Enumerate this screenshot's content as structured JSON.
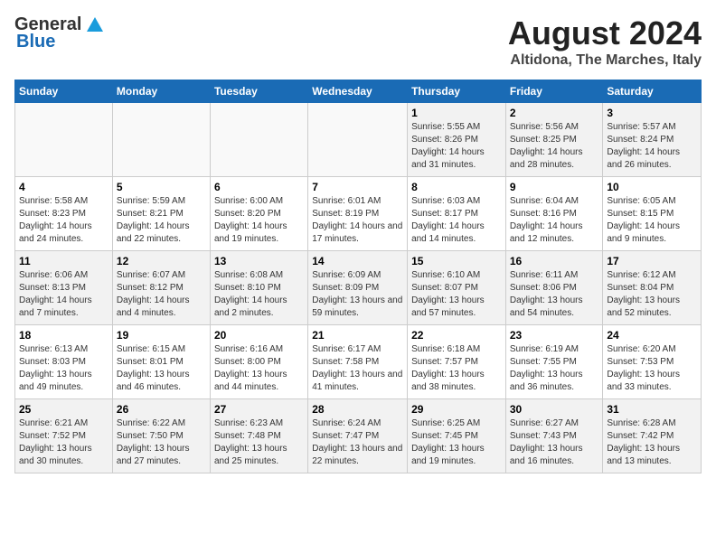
{
  "header": {
    "logo_general": "General",
    "logo_blue": "Blue",
    "month_title": "August 2024",
    "location": "Altidona, The Marches, Italy"
  },
  "days_of_week": [
    "Sunday",
    "Monday",
    "Tuesday",
    "Wednesday",
    "Thursday",
    "Friday",
    "Saturday"
  ],
  "weeks": [
    [
      {
        "day": "",
        "info": ""
      },
      {
        "day": "",
        "info": ""
      },
      {
        "day": "",
        "info": ""
      },
      {
        "day": "",
        "info": ""
      },
      {
        "day": "1",
        "info": "Sunrise: 5:55 AM\nSunset: 8:26 PM\nDaylight: 14 hours and 31 minutes."
      },
      {
        "day": "2",
        "info": "Sunrise: 5:56 AM\nSunset: 8:25 PM\nDaylight: 14 hours and 28 minutes."
      },
      {
        "day": "3",
        "info": "Sunrise: 5:57 AM\nSunset: 8:24 PM\nDaylight: 14 hours and 26 minutes."
      }
    ],
    [
      {
        "day": "4",
        "info": "Sunrise: 5:58 AM\nSunset: 8:23 PM\nDaylight: 14 hours and 24 minutes."
      },
      {
        "day": "5",
        "info": "Sunrise: 5:59 AM\nSunset: 8:21 PM\nDaylight: 14 hours and 22 minutes."
      },
      {
        "day": "6",
        "info": "Sunrise: 6:00 AM\nSunset: 8:20 PM\nDaylight: 14 hours and 19 minutes."
      },
      {
        "day": "7",
        "info": "Sunrise: 6:01 AM\nSunset: 8:19 PM\nDaylight: 14 hours and 17 minutes."
      },
      {
        "day": "8",
        "info": "Sunrise: 6:03 AM\nSunset: 8:17 PM\nDaylight: 14 hours and 14 minutes."
      },
      {
        "day": "9",
        "info": "Sunrise: 6:04 AM\nSunset: 8:16 PM\nDaylight: 14 hours and 12 minutes."
      },
      {
        "day": "10",
        "info": "Sunrise: 6:05 AM\nSunset: 8:15 PM\nDaylight: 14 hours and 9 minutes."
      }
    ],
    [
      {
        "day": "11",
        "info": "Sunrise: 6:06 AM\nSunset: 8:13 PM\nDaylight: 14 hours and 7 minutes."
      },
      {
        "day": "12",
        "info": "Sunrise: 6:07 AM\nSunset: 8:12 PM\nDaylight: 14 hours and 4 minutes."
      },
      {
        "day": "13",
        "info": "Sunrise: 6:08 AM\nSunset: 8:10 PM\nDaylight: 14 hours and 2 minutes."
      },
      {
        "day": "14",
        "info": "Sunrise: 6:09 AM\nSunset: 8:09 PM\nDaylight: 13 hours and 59 minutes."
      },
      {
        "day": "15",
        "info": "Sunrise: 6:10 AM\nSunset: 8:07 PM\nDaylight: 13 hours and 57 minutes."
      },
      {
        "day": "16",
        "info": "Sunrise: 6:11 AM\nSunset: 8:06 PM\nDaylight: 13 hours and 54 minutes."
      },
      {
        "day": "17",
        "info": "Sunrise: 6:12 AM\nSunset: 8:04 PM\nDaylight: 13 hours and 52 minutes."
      }
    ],
    [
      {
        "day": "18",
        "info": "Sunrise: 6:13 AM\nSunset: 8:03 PM\nDaylight: 13 hours and 49 minutes."
      },
      {
        "day": "19",
        "info": "Sunrise: 6:15 AM\nSunset: 8:01 PM\nDaylight: 13 hours and 46 minutes."
      },
      {
        "day": "20",
        "info": "Sunrise: 6:16 AM\nSunset: 8:00 PM\nDaylight: 13 hours and 44 minutes."
      },
      {
        "day": "21",
        "info": "Sunrise: 6:17 AM\nSunset: 7:58 PM\nDaylight: 13 hours and 41 minutes."
      },
      {
        "day": "22",
        "info": "Sunrise: 6:18 AM\nSunset: 7:57 PM\nDaylight: 13 hours and 38 minutes."
      },
      {
        "day": "23",
        "info": "Sunrise: 6:19 AM\nSunset: 7:55 PM\nDaylight: 13 hours and 36 minutes."
      },
      {
        "day": "24",
        "info": "Sunrise: 6:20 AM\nSunset: 7:53 PM\nDaylight: 13 hours and 33 minutes."
      }
    ],
    [
      {
        "day": "25",
        "info": "Sunrise: 6:21 AM\nSunset: 7:52 PM\nDaylight: 13 hours and 30 minutes."
      },
      {
        "day": "26",
        "info": "Sunrise: 6:22 AM\nSunset: 7:50 PM\nDaylight: 13 hours and 27 minutes."
      },
      {
        "day": "27",
        "info": "Sunrise: 6:23 AM\nSunset: 7:48 PM\nDaylight: 13 hours and 25 minutes."
      },
      {
        "day": "28",
        "info": "Sunrise: 6:24 AM\nSunset: 7:47 PM\nDaylight: 13 hours and 22 minutes."
      },
      {
        "day": "29",
        "info": "Sunrise: 6:25 AM\nSunset: 7:45 PM\nDaylight: 13 hours and 19 minutes."
      },
      {
        "day": "30",
        "info": "Sunrise: 6:27 AM\nSunset: 7:43 PM\nDaylight: 13 hours and 16 minutes."
      },
      {
        "day": "31",
        "info": "Sunrise: 6:28 AM\nSunset: 7:42 PM\nDaylight: 13 hours and 13 minutes."
      }
    ]
  ]
}
